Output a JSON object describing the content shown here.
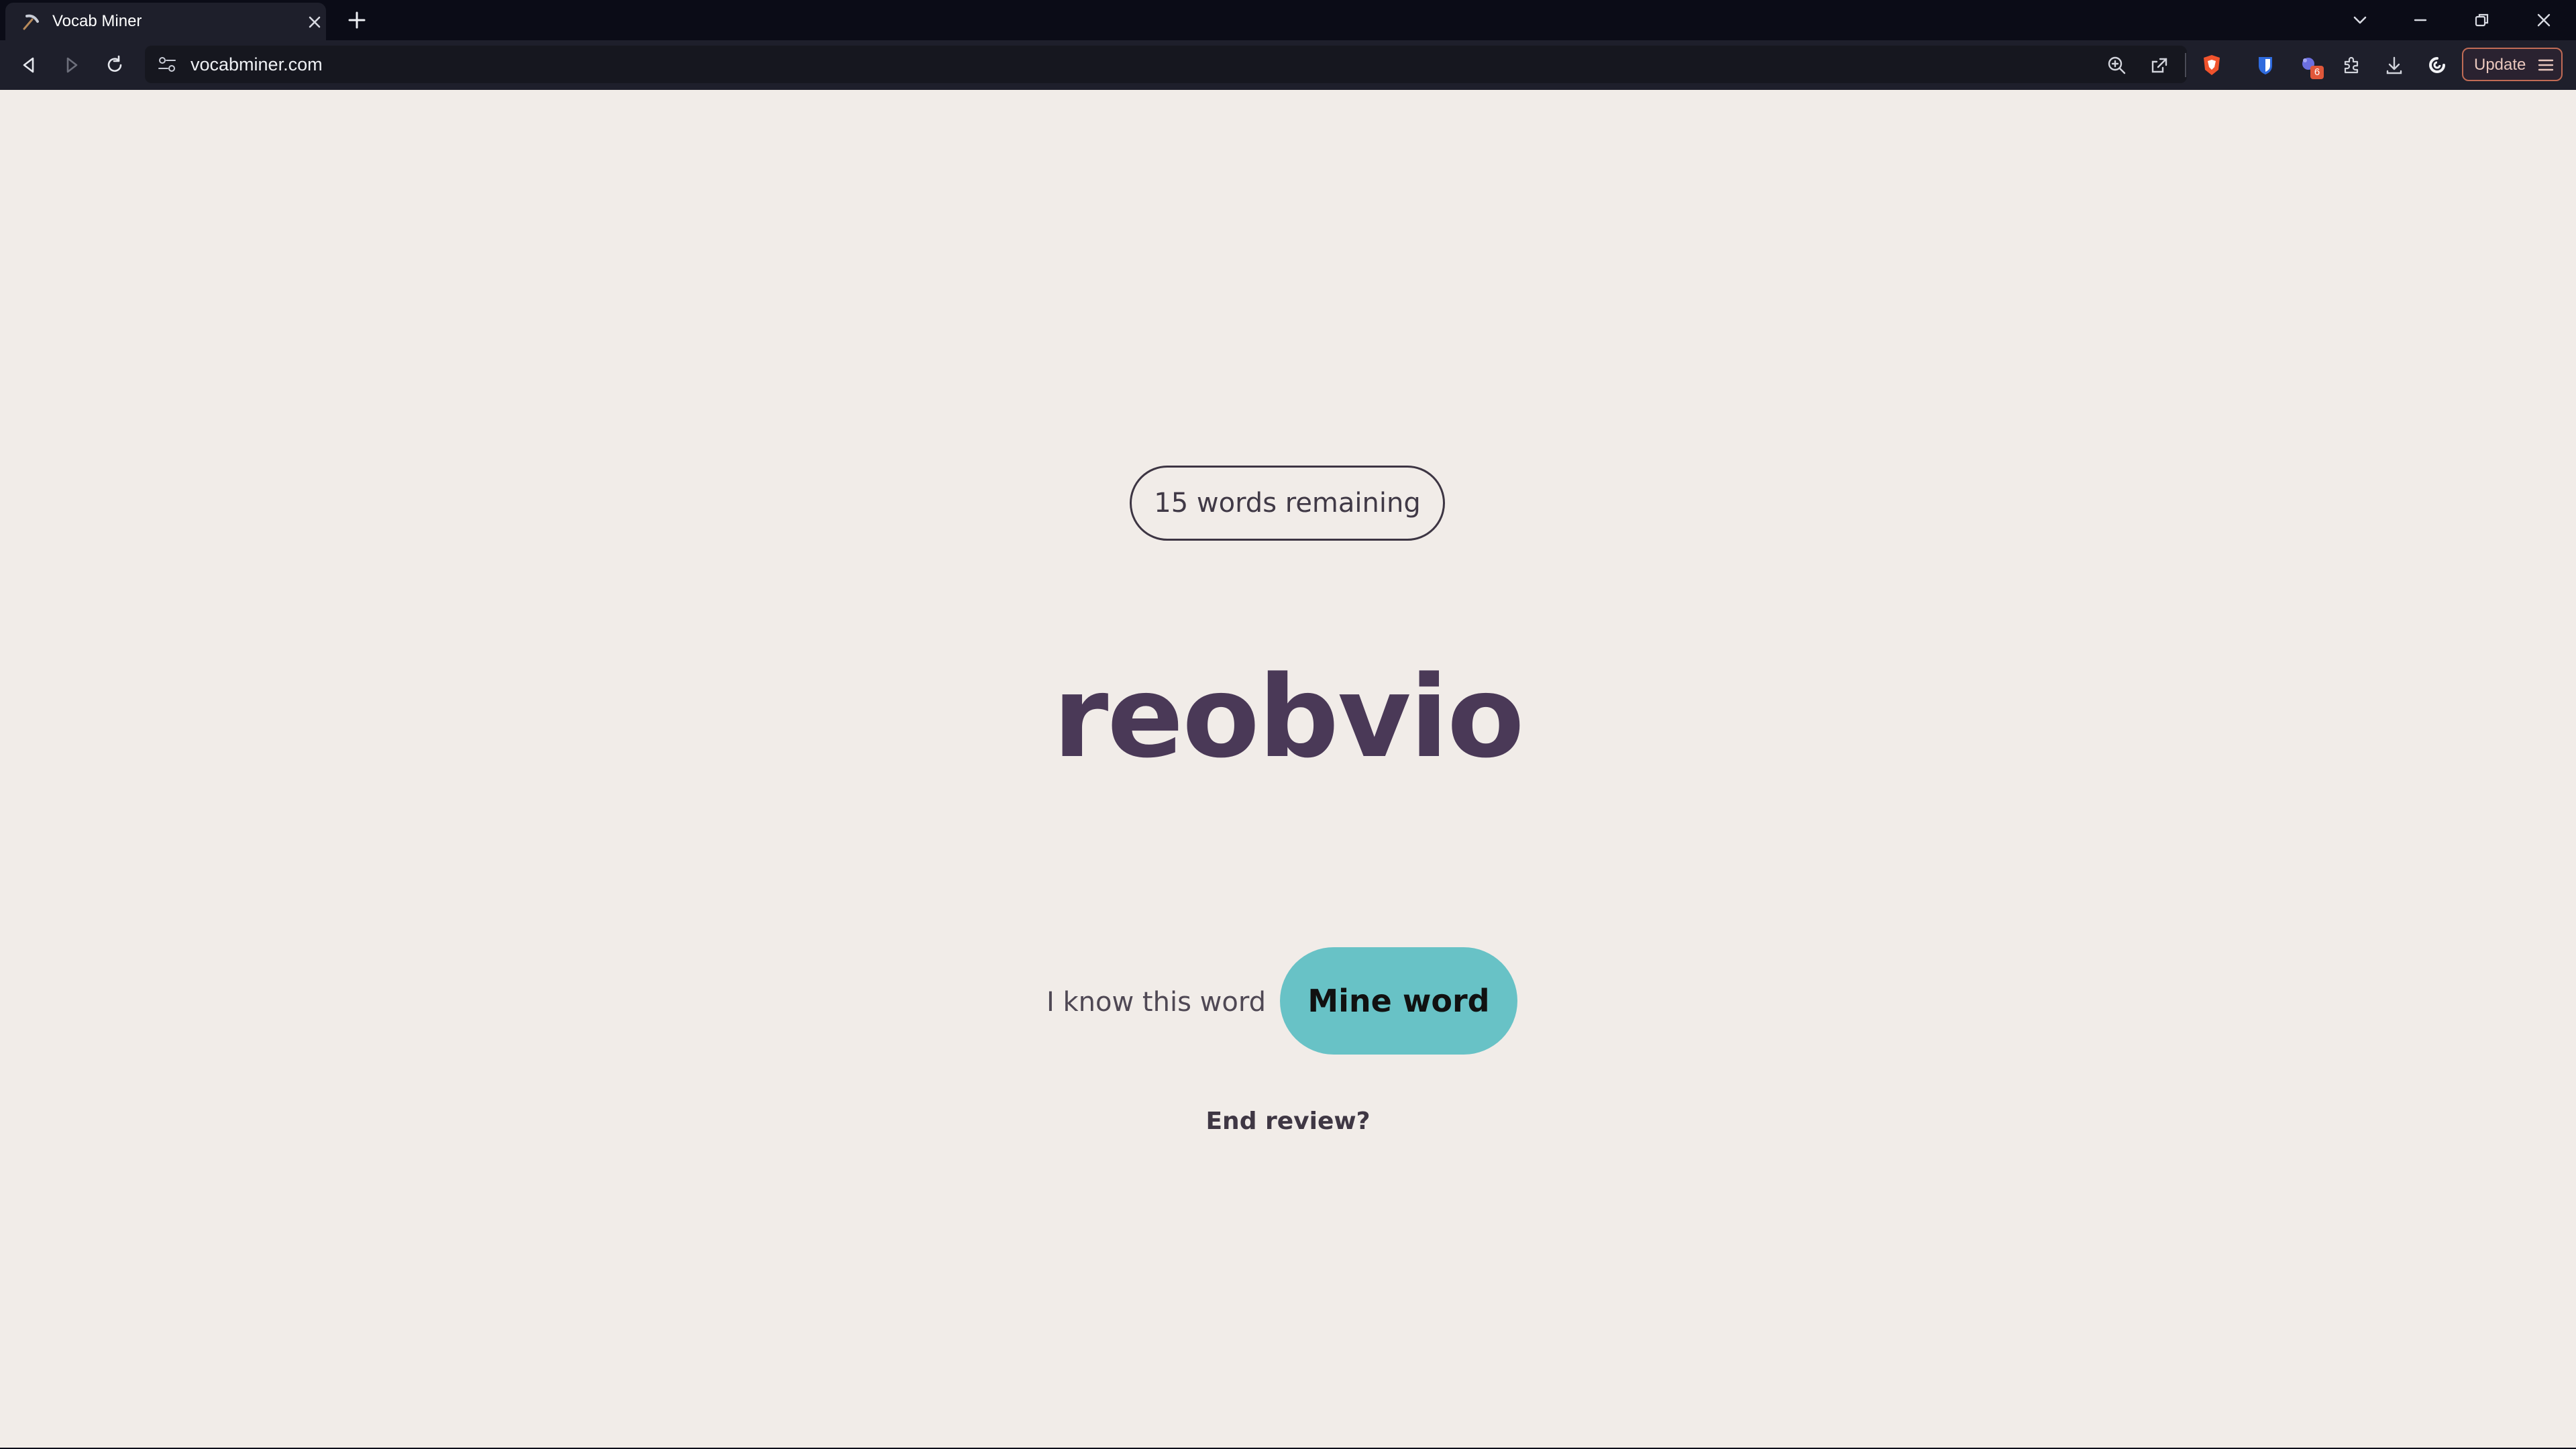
{
  "browser": {
    "tab": {
      "title": "Vocab Miner",
      "favicon": "pickaxe-icon"
    },
    "address_bar": {
      "url": "vocabminer.com"
    },
    "update_button": {
      "label": "Update"
    },
    "extension_badge_count": "6",
    "colors": {
      "tab_strip": "#0b0c17",
      "toolbar": "#1e1f2b",
      "update_border": "#c06b55"
    }
  },
  "review": {
    "remaining_label": "15 words remaining",
    "word": "reobvio",
    "know_label": "I know this word",
    "mine_label": "Mine word",
    "end_label": "End review?"
  },
  "theme": {
    "page_background": "#f1ece8",
    "word_color": "#4a3957",
    "mine_button_color": "#68c2c6"
  }
}
